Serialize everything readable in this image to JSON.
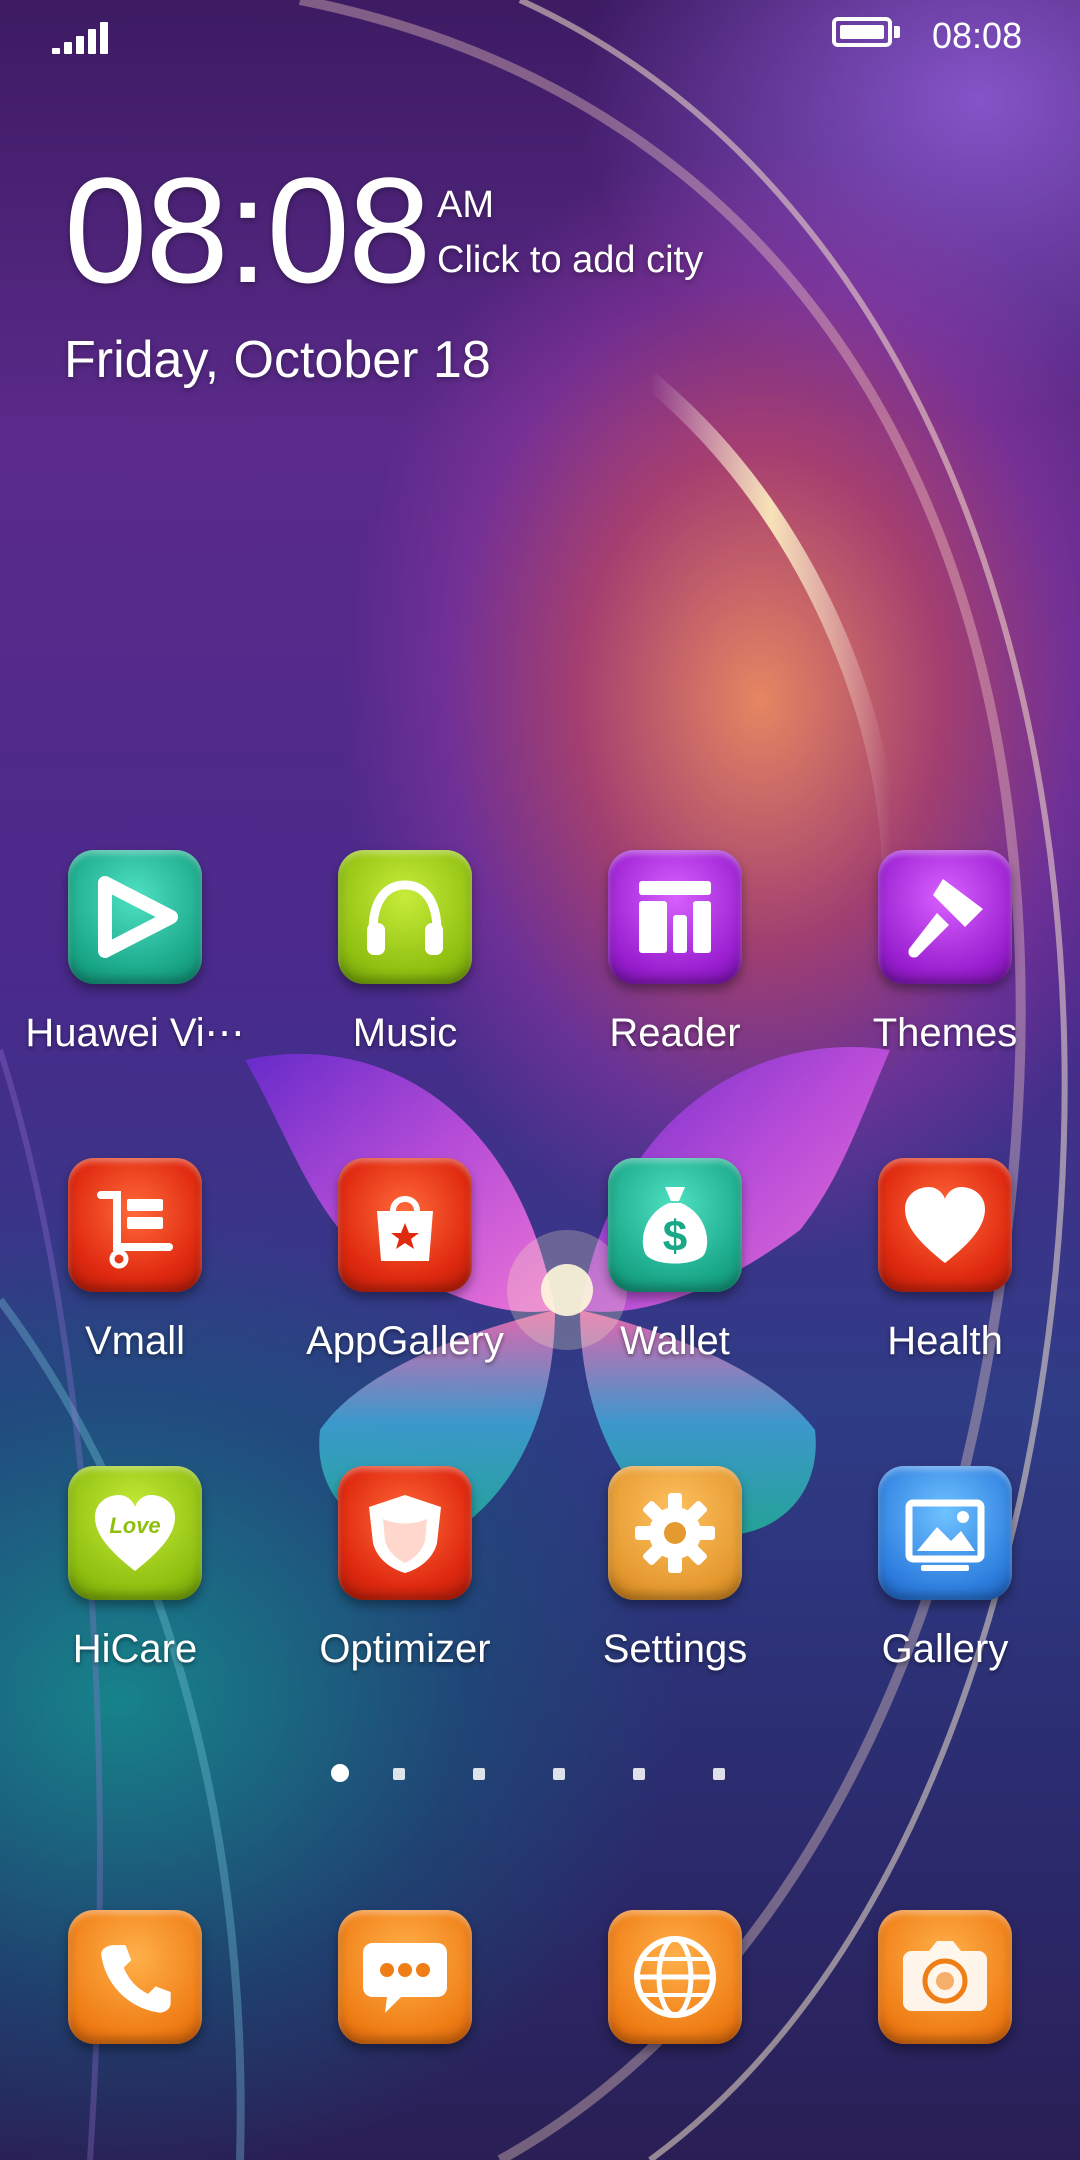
{
  "status_bar": {
    "time": "08:08",
    "signal_icon": "signal-bars-icon",
    "battery_icon": "battery-full-icon"
  },
  "clock_widget": {
    "time": "08:08",
    "ampm": "AM",
    "city_prompt": "Click to add city",
    "date": "Friday, October 18"
  },
  "apps": [
    {
      "label": "Huawei Vi⋯",
      "icon": "play-icon"
    },
    {
      "label": "Music",
      "icon": "headphones-icon"
    },
    {
      "label": "Reader",
      "icon": "book-icon"
    },
    {
      "label": "Themes",
      "icon": "paintbrush-icon"
    },
    {
      "label": "Vmall",
      "icon": "cart-icon"
    },
    {
      "label": "AppGallery",
      "icon": "shopping-bag-icon"
    },
    {
      "label": "Wallet",
      "icon": "money-bag-icon"
    },
    {
      "label": "Health",
      "icon": "heart-icon"
    },
    {
      "label": "HiCare",
      "icon": "love-heart-icon",
      "icon_text": "Love"
    },
    {
      "label": "Optimizer",
      "icon": "shield-icon"
    },
    {
      "label": "Settings",
      "icon": "gear-icon"
    },
    {
      "label": "Gallery",
      "icon": "picture-icon"
    }
  ],
  "page_indicator": {
    "pages": 6,
    "active": 1
  },
  "dock": [
    {
      "icon": "phone-icon"
    },
    {
      "icon": "message-icon"
    },
    {
      "icon": "browser-globe-icon"
    },
    {
      "icon": "camera-icon"
    }
  ]
}
